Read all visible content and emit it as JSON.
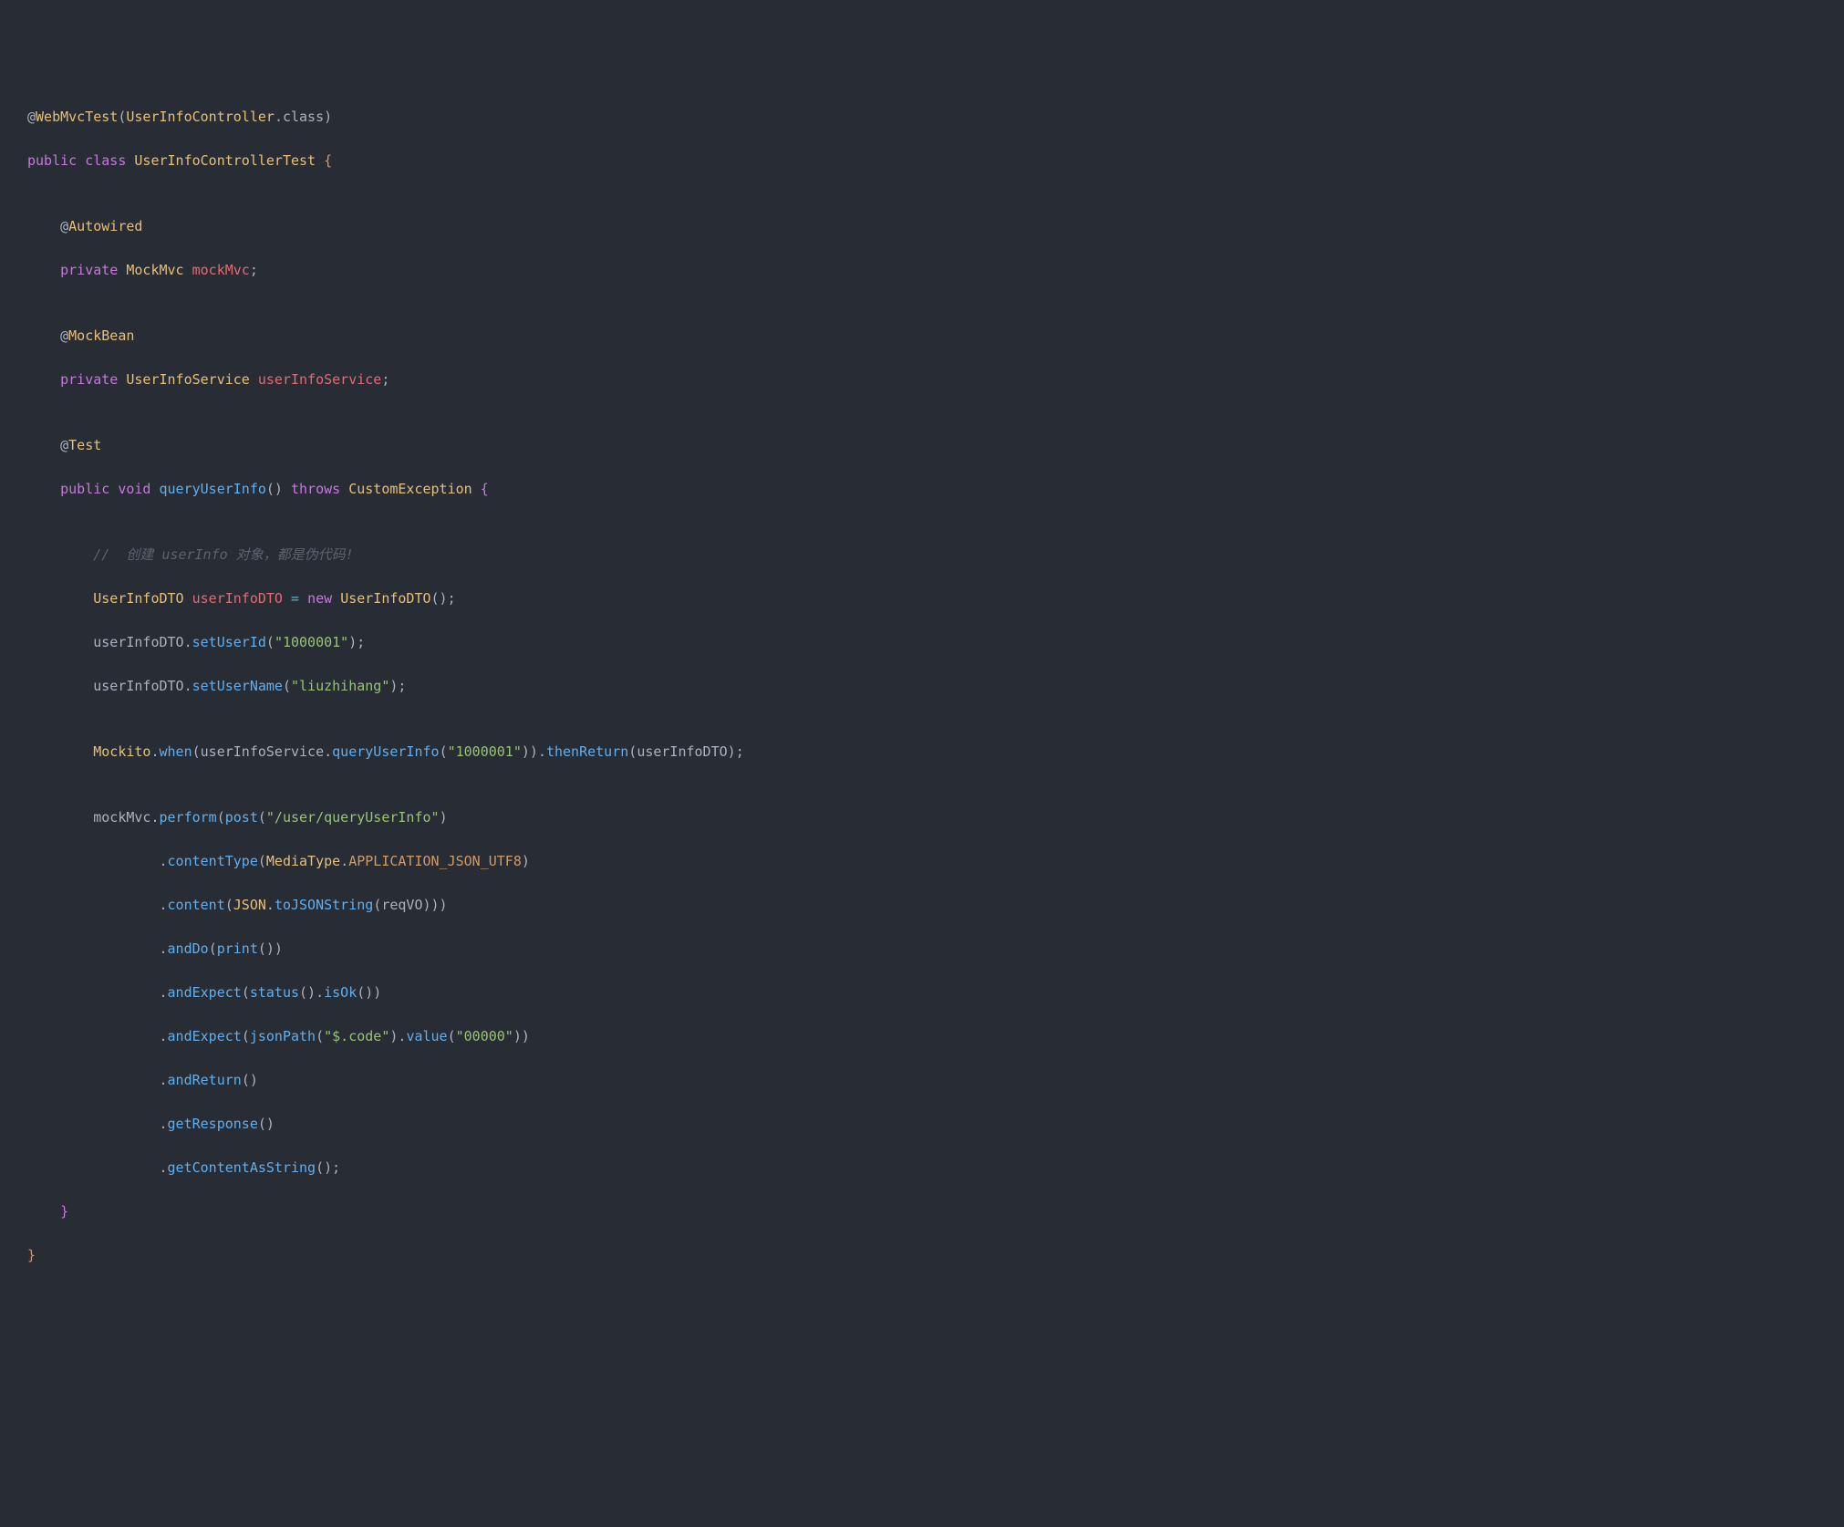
{
  "code": {
    "annotation1": "WebMvcTest",
    "controller_class": "UserInfoController",
    "class_keyword": "class",
    "public_keyword": "public",
    "private_keyword": "private",
    "void_keyword": "void",
    "new_keyword": "new",
    "throws_keyword": "throws",
    "test_class": "UserInfoControllerTest",
    "autowired": "Autowired",
    "mockbean": "MockBean",
    "test_annotation": "Test",
    "mockmvc_type": "MockMvc",
    "mockmvc_field": "mockMvc",
    "service_type": "UserInfoService",
    "service_field": "userInfoService",
    "test_method": "queryUserInfo",
    "exception_type": "CustomException",
    "comment": "//  创建 userInfo 对象，都是伪代码!",
    "dto_type": "UserInfoDTO",
    "dto_var": "userInfoDTO",
    "setUserId": "setUserId",
    "setUserName": "setUserName",
    "userId": "\"1000001\"",
    "userName": "\"liuzhihang\"",
    "mockito": "Mockito",
    "when": "when",
    "queryUserInfo": "queryUserInfo",
    "thenReturn": "thenReturn",
    "perform": "perform",
    "post": "post",
    "url": "\"/user/queryUserInfo\"",
    "contentType": "contentType",
    "mediaType": "MediaType",
    "json_utf8": "APPLICATION_JSON_UTF8",
    "content": "content",
    "json_class": "JSON",
    "toJSONString": "toJSONString",
    "reqVO": "reqVO",
    "andDo": "andDo",
    "print": "print",
    "andExpect": "andExpect",
    "status": "status",
    "isOk": "isOk",
    "jsonPath": "jsonPath",
    "code_path": "\"$.code\"",
    "value": "value",
    "code_val": "\"00000\"",
    "andReturn": "andReturn",
    "getResponse": "getResponse",
    "getContentAsString": "getContentAsString",
    "class_suffix": ".class"
  }
}
